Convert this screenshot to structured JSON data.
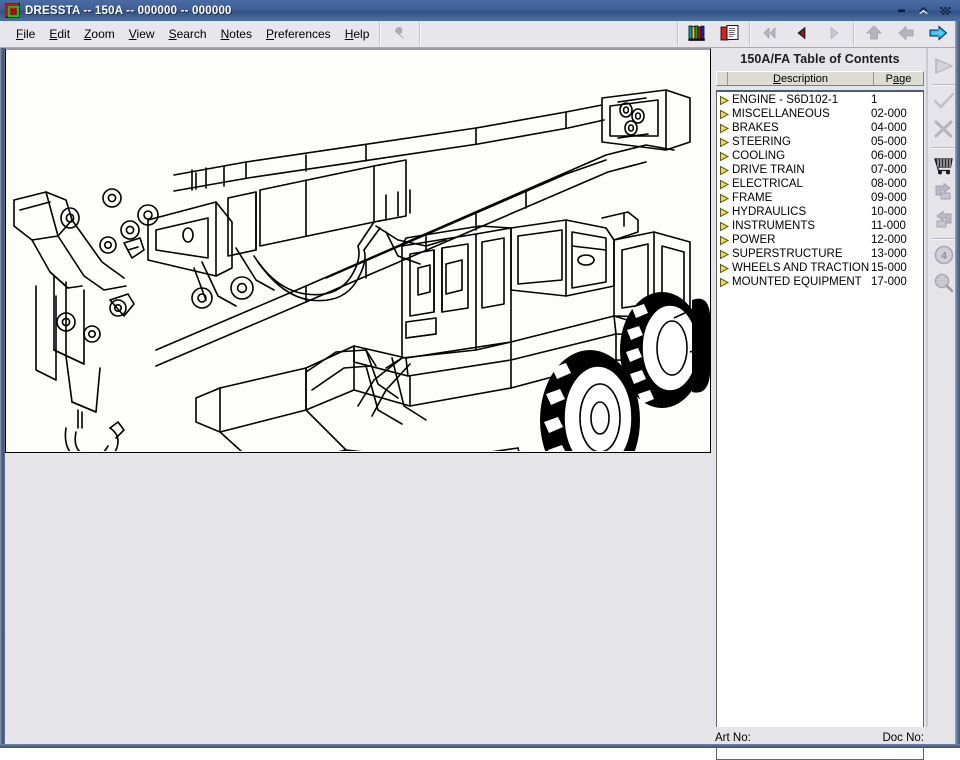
{
  "window": {
    "title": "DRESSTA -- 150A -- 000000 -- 000000",
    "logo_icon": "dressta-logo-icon",
    "controls": [
      {
        "name": "minimize-button",
        "icon": "minimize-icon"
      },
      {
        "name": "maximize-button",
        "icon": "maximize-icon"
      },
      {
        "name": "close-button",
        "icon": "close-icon"
      }
    ]
  },
  "menubar": {
    "items": [
      {
        "label": "File",
        "accel": "F"
      },
      {
        "label": "Edit",
        "accel": "E"
      },
      {
        "label": "Zoom",
        "accel": "Z"
      },
      {
        "label": "View",
        "accel": "V"
      },
      {
        "label": "Search",
        "accel": "S"
      },
      {
        "label": "Notes",
        "accel": "N"
      },
      {
        "label": "Preferences",
        "accel": "P"
      },
      {
        "label": "Help",
        "accel": "H"
      }
    ],
    "pin_icon": "pushpin-icon",
    "toolbar_right": [
      {
        "name": "library-books-button",
        "icon": "books-icon",
        "enabled": true
      },
      {
        "name": "document-book-button",
        "icon": "book-document-icon",
        "enabled": true
      },
      {
        "name": "first-page-button",
        "icon": "double-left-arrow-icon",
        "enabled": false
      },
      {
        "name": "previous-page-button",
        "icon": "left-triangle-icon",
        "enabled": true
      },
      {
        "name": "next-page-button",
        "icon": "right-triangle-icon",
        "enabled": false
      },
      {
        "name": "go-up-button",
        "icon": "up-arrow-icon",
        "enabled": false
      },
      {
        "name": "go-back-button",
        "icon": "left-arrow-icon",
        "enabled": false
      },
      {
        "name": "go-forward-button",
        "icon": "right-arrow-icon",
        "enabled": true
      }
    ]
  },
  "image_panel": {
    "name": "illustration-viewer",
    "content_description": "line drawing of DRESSTA 150A wheeled excavator / crane"
  },
  "toc": {
    "title": "150A/FA Table of Contents",
    "columns": {
      "blank": "",
      "description": "Description",
      "description_accel": "D",
      "page": "Page",
      "page_accel": "a"
    },
    "bullet_icon": "expand-triangle-icon",
    "rows": [
      {
        "description": "ENGINE - S6D102-1",
        "page": "1"
      },
      {
        "description": "MISCELLANEOUS",
        "page": "02-000"
      },
      {
        "description": "BRAKES",
        "page": "04-000"
      },
      {
        "description": "STEERING",
        "page": "05-000"
      },
      {
        "description": "COOLING",
        "page": "06-000"
      },
      {
        "description": "DRIVE TRAIN",
        "page": "07-000"
      },
      {
        "description": "ELECTRICAL",
        "page": "08-000"
      },
      {
        "description": "FRAME",
        "page": "09-000"
      },
      {
        "description": "HYDRAULICS",
        "page": "10-000"
      },
      {
        "description": "INSTRUMENTS",
        "page": "11-000"
      },
      {
        "description": "POWER",
        "page": "12-000"
      },
      {
        "description": "SUPERSTRUCTURE",
        "page": "13-000"
      },
      {
        "description": "WHEELS AND TRACTION",
        "page": "15-000"
      },
      {
        "description": "MOUNTED EQUIPMENT",
        "page": "17-000"
      }
    ]
  },
  "statusbar": {
    "art_no_label": "Art No:",
    "art_no_value": "",
    "doc_no_label": "Doc No:",
    "doc_no_value": ""
  },
  "vertical_toolbar": {
    "buttons": [
      {
        "name": "send-order-button",
        "icon": "play-triangle-icon",
        "enabled": false
      },
      {
        "name": "confirm-button",
        "icon": "checkmark-icon",
        "enabled": false
      },
      {
        "name": "cancel-button",
        "icon": "x-mark-icon",
        "enabled": false
      },
      {
        "name": "shopping-cart-button",
        "icon": "shopping-cart-icon",
        "enabled": true
      },
      {
        "name": "add-to-cart-button",
        "icon": "cart-add-icon",
        "enabled": false
      },
      {
        "name": "remove-from-cart-button",
        "icon": "cart-remove-icon",
        "enabled": false
      },
      {
        "name": "quantity-button",
        "icon": "circled-four-icon",
        "enabled": false
      },
      {
        "name": "zoom-search-button",
        "icon": "magnifier-icon",
        "enabled": false
      }
    ]
  },
  "colors": {
    "title_bar": "#3e5e95",
    "chrome": "#e4e4e9",
    "panel_bg": "#ffffff",
    "header_bg": "#dcdcd4",
    "bullet": "#f2dd40",
    "accent_red": "#cc0000",
    "accent_cyan": "#00b4e0"
  }
}
